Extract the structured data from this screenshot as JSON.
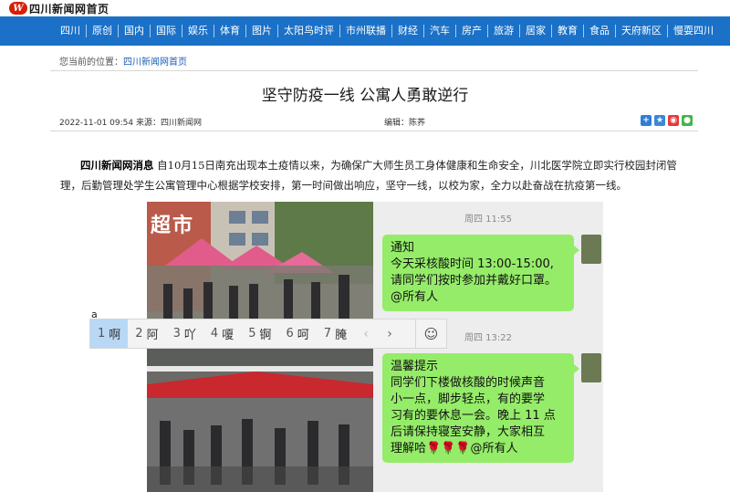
{
  "site": {
    "logo_mark": "W",
    "logo_text": "四川新闻网首页"
  },
  "nav": {
    "items": [
      "四川",
      "原创",
      "国内",
      "国际",
      "娱乐",
      "体育",
      "图片",
      "太阳鸟时评",
      "市州联播",
      "财经",
      "汽车",
      "房产",
      "旅游",
      "居家",
      "教育",
      "食品",
      "天府新区",
      "慢耍四川"
    ]
  },
  "breadcrumb": {
    "label": "您当前的位置：",
    "link": "四川新闻网首页"
  },
  "article": {
    "title": "坚守防疫一线 公寓人勇敢逆行",
    "date_source": "2022-11-01 09:54 来源：四川新闻网",
    "editor": "编辑：陈荞",
    "source_tag": "四川新闻网消息",
    "body": "自10月15日南充出现本土疫情以来，为确保广大师生员工身体健康和生命安全，川北医学院立即实行校园封闭管理，后勤管理处学生公寓管理中心根据学校安排，第一时间做出响应，坚守一线，以校为家，全力以赴奋战在抗疫第一线。"
  },
  "share": {
    "icons": [
      "share-plus-icon",
      "qzone-icon",
      "weibo-icon",
      "wechat-icon"
    ],
    "colors": [
      "#2f7fd6",
      "#3a88d8",
      "#e4393c",
      "#44b549"
    ]
  },
  "photo": {
    "sign_text": "超市",
    "chat": {
      "time1": "周四 11:55",
      "msg1": [
        "通知",
        "今天采核酸时间 13:00-15:00,",
        "请同学们按时参加并戴好口罩。",
        "@所有人"
      ],
      "time2": "周四 13:22",
      "msg2": [
        "温馨提示",
        "同学们下楼做核酸的时候声音",
        "小一点，脚步轻点，有的要学",
        "习有的要休息一会。晚上 11 点",
        "后请保持寝室安静，大家相互",
        "理解哈🌹🌹🌹@所有人"
      ]
    }
  },
  "ime": {
    "composition": "a",
    "candidates": [
      {
        "num": "1",
        "text": "啊"
      },
      {
        "num": "2",
        "text": "阿"
      },
      {
        "num": "3",
        "text": "吖"
      },
      {
        "num": "4",
        "text": "嗄"
      },
      {
        "num": "5",
        "text": "锕"
      },
      {
        "num": "6",
        "text": "呵"
      },
      {
        "num": "7",
        "text": "腌"
      }
    ],
    "prev": "‹",
    "next": "›",
    "emoji": "☺"
  },
  "colors": {
    "nav_bg": "#1a71c7",
    "bubble_green": "#95ec69",
    "chat_bg": "#ededed",
    "logo_red": "#d81e06"
  }
}
